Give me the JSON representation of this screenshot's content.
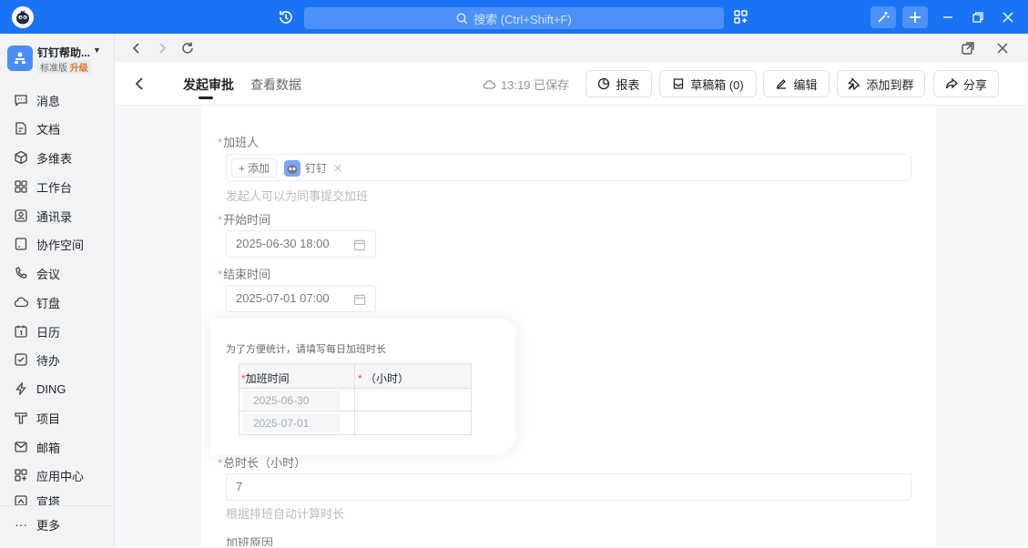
{
  "titlebar": {
    "search_placeholder": "搜索 (Ctrl+Shift+F)",
    "accent": "#1a73f5"
  },
  "org": {
    "name": "钉钉帮助...",
    "plan": "标准版",
    "upgrade": "升级"
  },
  "sidebar": {
    "items": [
      {
        "label": "消息",
        "icon": "message-icon"
      },
      {
        "label": "文档",
        "icon": "document-icon"
      },
      {
        "label": "多维表",
        "icon": "cube-icon"
      },
      {
        "label": "工作台",
        "icon": "workbench-icon"
      },
      {
        "label": "通讯录",
        "icon": "contacts-icon"
      },
      {
        "label": "协作空间",
        "icon": "workspace-icon"
      },
      {
        "label": "会议",
        "icon": "meeting-icon"
      },
      {
        "label": "钉盘",
        "icon": "cloud-drive-icon"
      },
      {
        "label": "日历",
        "icon": "calendar-icon"
      },
      {
        "label": "待办",
        "icon": "todo-icon"
      },
      {
        "label": "DING",
        "icon": "ding-icon"
      },
      {
        "label": "项目",
        "icon": "project-icon"
      },
      {
        "label": "邮箱",
        "icon": "mail-icon"
      },
      {
        "label": "应用中心",
        "icon": "app-center-icon"
      },
      {
        "label": "宣塔",
        "icon": "broadcast-icon"
      }
    ],
    "more": "更多"
  },
  "header": {
    "tabs": [
      {
        "label": "发起审批",
        "active": true
      },
      {
        "label": "查看数据",
        "active": false
      }
    ],
    "saved": "13:19 已保存",
    "buttons": {
      "report": "报表",
      "drafts": "草稿箱 (0)",
      "edit": "编辑",
      "add_to_group": "添加到群",
      "share": "分享"
    }
  },
  "form": {
    "overtime_person": {
      "label": "加班人",
      "add": "+ 添加",
      "person": "钉钉",
      "hint": "发起人可以为同事提交加班"
    },
    "start": {
      "label": "开始时间",
      "value": "2025-06-30 18:00"
    },
    "end": {
      "label": "结束时间",
      "value": "2025-07-01 07:00"
    },
    "daily": {
      "hint": "为了方便统计，请填写每日加班时长",
      "col1": "加班时间",
      "col2": "（小时）",
      "rows": [
        "2025-06-30",
        "2025-07-01"
      ]
    },
    "total": {
      "label": "总时长（小时）",
      "value": "7",
      "hint": "根据排班自动计算时长"
    },
    "reason": {
      "label": "加班原因"
    }
  }
}
